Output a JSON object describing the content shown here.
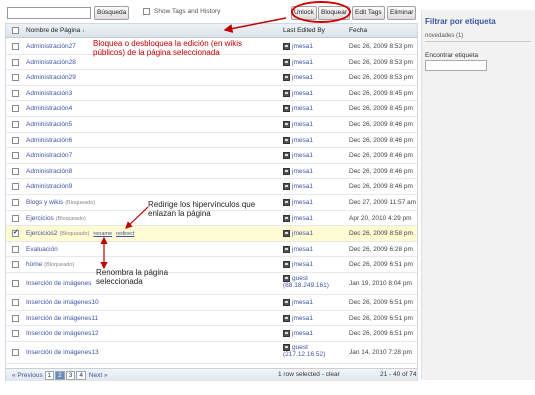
{
  "toolbar": {
    "search_placeholder": "",
    "search_button": "Búsqueda",
    "show_tags_label": "Show Tags and History",
    "unlock_button": "Unlock",
    "lock_button": "Bloquear",
    "edit_tags_button": "Edit Tags",
    "delete_button": "Eliminar"
  },
  "table": {
    "headers": {
      "name": "Nombre de Página",
      "edited_by": "Last Edited By",
      "date": "Fecha"
    },
    "rows": [
      {
        "name": "Administración27",
        "locked": "",
        "user": "jmesa1",
        "user_ip": "",
        "date": "Dec 26, 2009 8:53 pm",
        "selected": false
      },
      {
        "name": "Administración28",
        "locked": "",
        "user": "jmesa1",
        "user_ip": "",
        "date": "Dec 26, 2009 8:53 pm",
        "selected": false
      },
      {
        "name": "Administración29",
        "locked": "",
        "user": "jmesa1",
        "user_ip": "",
        "date": "Dec 26, 2009 8:53 pm",
        "selected": false
      },
      {
        "name": "Administración3",
        "locked": "",
        "user": "jmesa1",
        "user_ip": "",
        "date": "Dec 26, 2009 8:45 pm",
        "selected": false
      },
      {
        "name": "Administración4",
        "locked": "",
        "user": "jmesa1",
        "user_ip": "",
        "date": "Dec 26, 2009 8:45 pm",
        "selected": false
      },
      {
        "name": "Administración5",
        "locked": "",
        "user": "jmesa1",
        "user_ip": "",
        "date": "Dec 26, 2009 8:46 pm",
        "selected": false
      },
      {
        "name": "Administración6",
        "locked": "",
        "user": "jmesa1",
        "user_ip": "",
        "date": "Dec 26, 2009 8:46 pm",
        "selected": false
      },
      {
        "name": "Administración7",
        "locked": "",
        "user": "jmesa1",
        "user_ip": "",
        "date": "Dec 26, 2009 8:46 pm",
        "selected": false
      },
      {
        "name": "Administración8",
        "locked": "",
        "user": "jmesa1",
        "user_ip": "",
        "date": "Dec 26, 2009 8:46 pm",
        "selected": false
      },
      {
        "name": "Administración9",
        "locked": "",
        "user": "jmesa1",
        "user_ip": "",
        "date": "Dec 26, 2009 8:46 pm",
        "selected": false
      },
      {
        "name": "Blogs y wikis",
        "locked": "(Bloqueado)",
        "user": "jmesa1",
        "user_ip": "",
        "date": "Dec 27, 2009 11:57 am",
        "selected": false
      },
      {
        "name": "Ejercicios",
        "locked": "(Bloqueado)",
        "user": "jmesa1",
        "user_ip": "",
        "date": "Apr 20, 2010 4:29 pm",
        "selected": false
      },
      {
        "name": "Ejercicios2",
        "locked": "(Bloqueado)",
        "user": "jmesa1",
        "user_ip": "",
        "date": "Dec 26, 2009 8:58 pm",
        "selected": true
      },
      {
        "name": "Evaluación",
        "locked": "",
        "user": "jmesa1",
        "user_ip": "",
        "date": "Dec 26, 2009 6:28 pm",
        "selected": false
      },
      {
        "name": "home",
        "locked": "(Bloqueado)",
        "user": "jmesa1",
        "user_ip": "",
        "date": "Dec 26, 2009 6:51 pm",
        "selected": false
      },
      {
        "name": "Inserción de imágenes",
        "locked": "",
        "user": "guest",
        "user_ip": "(88.18.249.161)",
        "date": "Jan 19, 2010 8:04 pm",
        "selected": false
      },
      {
        "name": "Inserción de imágenes10",
        "locked": "",
        "user": "jmesa1",
        "user_ip": "",
        "date": "Dec 26, 2009 6:51 pm",
        "selected": false
      },
      {
        "name": "Inserción de imágenes11",
        "locked": "",
        "user": "jmesa1",
        "user_ip": "",
        "date": "Dec 26, 2009 6:51 pm",
        "selected": false
      },
      {
        "name": "Inserción de imágenes12",
        "locked": "",
        "user": "jmesa1",
        "user_ip": "",
        "date": "Dec 26, 2009 6:51 pm",
        "selected": false
      },
      {
        "name": "Inserción de imágenes13",
        "locked": "",
        "user": "guest",
        "user_ip": "(217.12.16.52)",
        "date": "Jan 14, 2010 7:28 pm",
        "selected": false
      }
    ],
    "selected_row_actions": {
      "rename": "rename",
      "redirect": "redirect"
    }
  },
  "footer": {
    "previous": "« Previous",
    "pages": [
      "1",
      "2",
      "3",
      "4"
    ],
    "current_page": "2",
    "next": "Next »",
    "status": "1 row selected - clear",
    "range": "21 - 40 of 74"
  },
  "sidebar": {
    "title": "Filtrar por etiqueta",
    "tag_item": "novedades (1)",
    "find_label": "Encontrar etiqueta"
  },
  "annotations": {
    "lock_note": "Bloquea o desbloquea la edición (en wikis públicos) de la página seleccionada",
    "redirect_note": "Redirige los hipervínculos que enlazan la página",
    "rename_note": "Renombra la página seleccionada"
  },
  "colors": {
    "link": "#4052a8",
    "annotation": "#c00000",
    "selected_row": "#fffbd2"
  }
}
